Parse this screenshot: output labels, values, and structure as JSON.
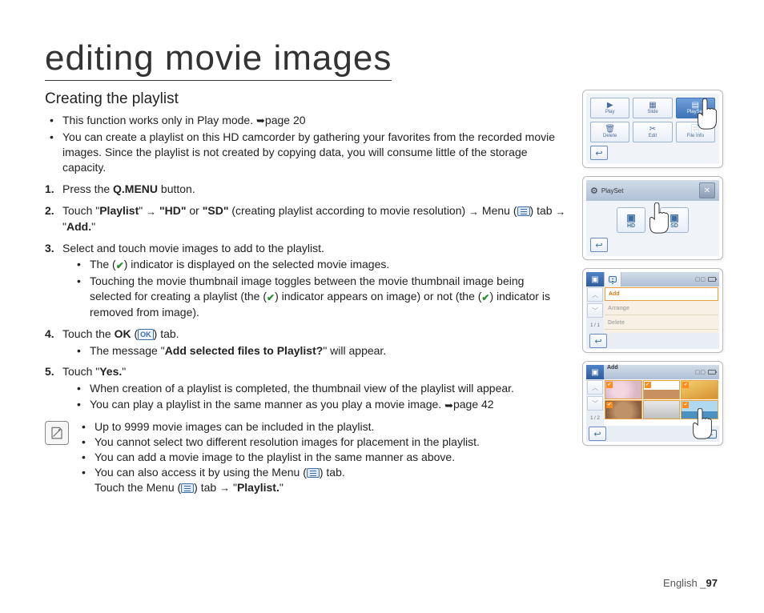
{
  "pageTitle": "editing movie images",
  "sectionTitle": "Creating the playlist",
  "intro": {
    "l1a": "This function works only in Play mode. ",
    "l1b": "page 20",
    "l2": "You can create a playlist on this HD camcorder by gathering your favorites from the recorded movie images. Since the playlist is not created by copying data, you will consume little of the storage capacity."
  },
  "steps": {
    "s1a": "Press the ",
    "s1b": "Q.MENU",
    "s1c": " button.",
    "s2a": "Touch \"",
    "s2b": "Playlist",
    "s2c": "\" ",
    "s2d": " \"HD\"",
    "s2e": " or ",
    "s2f": "\"SD\"",
    "s2g": " (creating playlist according to movie resolution) ",
    "s2h": " Menu (",
    "s2i": ") tab ",
    "s2j": " \"",
    "s2k": "Add.",
    "s2l": "\"",
    "s3": "Select and touch movie images to add to the playlist.",
    "s3sub1a": "The (",
    "s3sub1b": ") indicator is displayed on the selected movie images.",
    "s3sub2a": "Touching the movie thumbnail image toggles between the movie thumbnail image being selected for creating a playlist (the (",
    "s3sub2b": ") indicator appears on image) or not (the (",
    "s3sub2c": ") indicator is removed from image).",
    "s4a": "Touch the ",
    "s4b": "OK",
    "s4c": " (",
    "s4d": ") tab.",
    "s4sub1a": "The message \"",
    "s4sub1b": "Add selected files to Playlist?",
    "s4sub1c": "\" will appear.",
    "s5a": "Touch \"",
    "s5b": "Yes.",
    "s5c": "\"",
    "s5sub1": "When creation of a playlist is completed, the thumbnail view of the playlist will appear.",
    "s5sub2a": "You can play a playlist in the same manner as you play a movie image. ",
    "s5sub2b": "page 42"
  },
  "notes": {
    "n1": "Up to 9999 movie images can be included in the playlist.",
    "n2": "You cannot select two different resolution images for placement in the playlist.",
    "n3": "You can add a movie image to the playlist in the same manner as above.",
    "n4a": "You can also access it by using the Menu (",
    "n4b": ") tab.",
    "n5a": "Touch the Menu (",
    "n5b": ") tab ",
    "n5c": " \"",
    "n5d": "Playlist.",
    "n5e": "\""
  },
  "footer": {
    "lang": "English ",
    "sep": "_",
    "page": "97"
  },
  "okLabel": "OK",
  "screens": {
    "s1": {
      "btns": [
        {
          "icon": "▶",
          "label": "Play"
        },
        {
          "icon": "▦",
          "label": "Slide"
        },
        {
          "icon": "▤",
          "label": "PlaySet",
          "sel": true
        },
        {
          "icon": "🗑",
          "label": "Delete"
        },
        {
          "icon": "✂",
          "label": "Edit"
        },
        {
          "icon": "📄",
          "label": "File Info"
        }
      ]
    },
    "s2": {
      "title": "PlaySet",
      "opt1": "HD",
      "opt2": "SD"
    },
    "s3": {
      "items": [
        "Add",
        "Arrange",
        "Delete"
      ],
      "count": "1 / 1"
    },
    "s4": {
      "title": "Add",
      "count": "1 / 2",
      "ok": "OK"
    }
  }
}
